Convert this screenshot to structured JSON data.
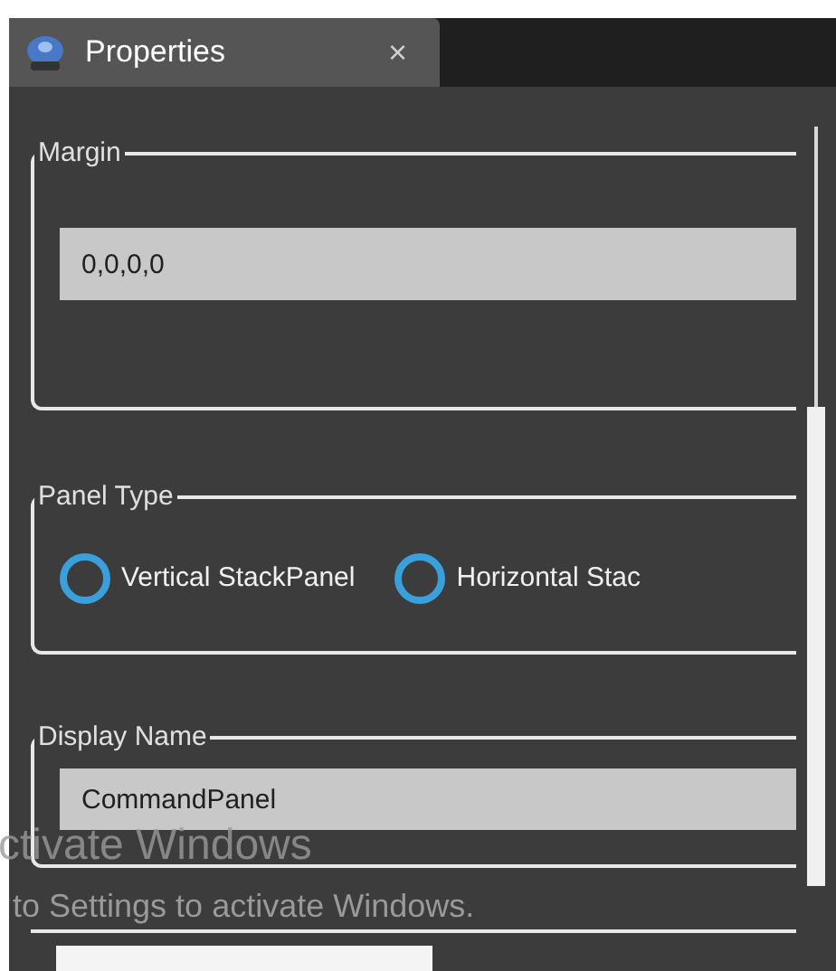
{
  "tab": {
    "title": "Properties",
    "close": "×"
  },
  "groups": [
    {
      "kind": "field",
      "label": "Margin",
      "value": "0,0,0,0"
    },
    {
      "kind": "radios",
      "label": "Panel Type",
      "options": [
        {
          "label": "Vertical StackPanel",
          "selected": false
        },
        {
          "label": "Horizontal Stac",
          "selected": false
        }
      ]
    },
    {
      "kind": "field",
      "label": "Display Name",
      "value": "CommandPanel"
    }
  ],
  "activation_notice": {
    "title": "ctivate Windows",
    "text": "to Settings to activate Windows."
  }
}
